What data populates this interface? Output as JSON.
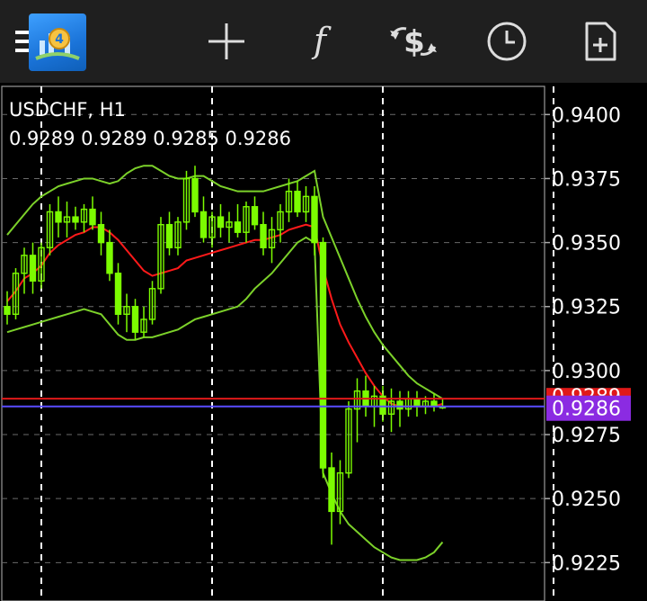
{
  "toolbar": {
    "icons": [
      "menu-icon",
      "app-logo-icon",
      "crosshair-icon",
      "function-icon",
      "trade-icon",
      "clock-icon",
      "new-document-icon"
    ],
    "function_glyph": "f"
  },
  "chart": {
    "symbol": "USDCHF, H1",
    "ohlc": "0.9289 0.9289 0.9285 0.9286",
    "bid_price": "0.9286",
    "ask_price": "0.9289",
    "bid_color": "#8B2BE2",
    "ask_color": "#E01919",
    "bull_color": "#7CFC00",
    "indicator_color": "#7CD12A",
    "ma_color": "#FF1A1A"
  },
  "chart_data": {
    "type": "candlestick",
    "title": "USDCHF, H1",
    "ylim": [
      0.921,
      0.9411
    ],
    "y_ticks": [
      "0.9400",
      "0.9375",
      "0.9350",
      "0.9325",
      "0.9300",
      "0.9275",
      "0.9250",
      "0.9225"
    ],
    "y_tick_values": [
      0.94,
      0.9375,
      0.935,
      0.9325,
      0.93,
      0.9275,
      0.925,
      0.9225
    ],
    "grid": true,
    "period_separators": 4,
    "series": [
      {
        "name": "candles",
        "values": [
          [
            0.9325,
            0.9331,
            0.9318,
            0.9322
          ],
          [
            0.9322,
            0.934,
            0.932,
            0.9338
          ],
          [
            0.9338,
            0.9348,
            0.933,
            0.9345
          ],
          [
            0.9345,
            0.935,
            0.933,
            0.9335
          ],
          [
            0.9335,
            0.935,
            0.9332,
            0.9348
          ],
          [
            0.9348,
            0.9365,
            0.9345,
            0.9362
          ],
          [
            0.9362,
            0.9368,
            0.9352,
            0.9358
          ],
          [
            0.9358,
            0.9366,
            0.9352,
            0.936
          ],
          [
            0.936,
            0.9364,
            0.9355,
            0.9358
          ],
          [
            0.9358,
            0.9365,
            0.9354,
            0.9363
          ],
          [
            0.9363,
            0.9368,
            0.9355,
            0.9357
          ],
          [
            0.9357,
            0.9362,
            0.9345,
            0.935
          ],
          [
            0.935,
            0.9355,
            0.9335,
            0.9338
          ],
          [
            0.9338,
            0.9342,
            0.9318,
            0.9322
          ],
          [
            0.9322,
            0.933,
            0.9315,
            0.9325
          ],
          [
            0.9325,
            0.9328,
            0.9312,
            0.9315
          ],
          [
            0.9315,
            0.9325,
            0.9313,
            0.932
          ],
          [
            0.932,
            0.9335,
            0.9318,
            0.9332
          ],
          [
            0.9332,
            0.936,
            0.933,
            0.9357
          ],
          [
            0.9357,
            0.9362,
            0.9345,
            0.9348
          ],
          [
            0.9348,
            0.936,
            0.9345,
            0.9358
          ],
          [
            0.9358,
            0.9378,
            0.9355,
            0.9375
          ],
          [
            0.9375,
            0.938,
            0.936,
            0.9362
          ],
          [
            0.9362,
            0.9368,
            0.935,
            0.9352
          ],
          [
            0.9352,
            0.9362,
            0.9348,
            0.936
          ],
          [
            0.936,
            0.9365,
            0.9352,
            0.9356
          ],
          [
            0.9356,
            0.9362,
            0.935,
            0.9358
          ],
          [
            0.9358,
            0.9365,
            0.9352,
            0.9354
          ],
          [
            0.9354,
            0.9366,
            0.935,
            0.9364
          ],
          [
            0.9364,
            0.9368,
            0.9355,
            0.9357
          ],
          [
            0.9357,
            0.9362,
            0.9345,
            0.9348
          ],
          [
            0.9348,
            0.936,
            0.9342,
            0.9355
          ],
          [
            0.9355,
            0.9365,
            0.935,
            0.9362
          ],
          [
            0.9362,
            0.9375,
            0.9358,
            0.937
          ],
          [
            0.937,
            0.9374,
            0.936,
            0.9362
          ],
          [
            0.9362,
            0.9372,
            0.9358,
            0.9368
          ],
          [
            0.9368,
            0.9372,
            0.9345,
            0.935
          ],
          [
            0.935,
            0.9352,
            0.9258,
            0.9262
          ],
          [
            0.9262,
            0.9268,
            0.9232,
            0.9245
          ],
          [
            0.9245,
            0.9265,
            0.924,
            0.926
          ],
          [
            0.926,
            0.9288,
            0.9258,
            0.9285
          ],
          [
            0.9285,
            0.9297,
            0.9272,
            0.9292
          ],
          [
            0.9292,
            0.9298,
            0.9282,
            0.9286
          ],
          [
            0.9286,
            0.9294,
            0.9278,
            0.929
          ],
          [
            0.929,
            0.9294,
            0.928,
            0.9283
          ],
          [
            0.9283,
            0.9293,
            0.9276,
            0.9288
          ],
          [
            0.9288,
            0.9292,
            0.9278,
            0.9285
          ],
          [
            0.9285,
            0.9292,
            0.9282,
            0.9289
          ],
          [
            0.9289,
            0.9292,
            0.9282,
            0.9286
          ],
          [
            0.9286,
            0.929,
            0.9283,
            0.9288
          ],
          [
            0.9288,
            0.9291,
            0.9284,
            0.9286
          ],
          [
            0.9286,
            0.9289,
            0.9285,
            0.9286
          ]
        ]
      },
      {
        "name": "band-mid",
        "values": [
          0.9327,
          0.9331,
          0.9336,
          0.9338,
          0.9341,
          0.9346,
          0.9349,
          0.9351,
          0.9353,
          0.9354,
          0.9356,
          0.9356,
          0.9354,
          0.9351,
          0.9347,
          0.9343,
          0.9339,
          0.9337,
          0.9338,
          0.9339,
          0.934,
          0.9343,
          0.9344,
          0.9345,
          0.9346,
          0.9347,
          0.9348,
          0.9349,
          0.935,
          0.9351,
          0.9351,
          0.9352,
          0.9353,
          0.9355,
          0.9356,
          0.9357,
          0.9356,
          0.934,
          0.9328,
          0.9318,
          0.9311,
          0.9305,
          0.9299,
          0.9294,
          0.929,
          0.9287,
          0.9286,
          0.9286,
          0.9286,
          0.9286,
          0.9286,
          0.9287
        ]
      },
      {
        "name": "band-upper",
        "values": [
          0.9353,
          0.9357,
          0.9361,
          0.9365,
          0.9368,
          0.937,
          0.9372,
          0.9373,
          0.9374,
          0.9375,
          0.9375,
          0.9374,
          0.9373,
          0.9374,
          0.9377,
          0.9379,
          0.938,
          0.938,
          0.9378,
          0.9376,
          0.9375,
          0.9375,
          0.9376,
          0.9376,
          0.9374,
          0.9372,
          0.9371,
          0.937,
          0.937,
          0.937,
          0.937,
          0.9371,
          0.9372,
          0.9373,
          0.9374,
          0.9376,
          0.9378,
          0.936,
          0.9352,
          0.9344,
          0.9336,
          0.9328,
          0.9321,
          0.9315,
          0.931,
          0.9306,
          0.9302,
          0.9298,
          0.9295,
          0.9293,
          0.9291,
          0.9289
        ]
      },
      {
        "name": "band-lower",
        "values": [
          0.9315,
          0.9316,
          0.9317,
          0.9318,
          0.9319,
          0.932,
          0.9321,
          0.9322,
          0.9323,
          0.9324,
          0.9323,
          0.9322,
          0.9318,
          0.9314,
          0.9312,
          0.9312,
          0.9313,
          0.9313,
          0.9314,
          0.9315,
          0.9316,
          0.9318,
          0.932,
          0.9321,
          0.9322,
          0.9323,
          0.9324,
          0.9325,
          0.9328,
          0.9332,
          0.9335,
          0.9338,
          0.9342,
          0.9346,
          0.935,
          0.9352,
          0.935,
          0.926,
          0.9252,
          0.9245,
          0.924,
          0.9237,
          0.9234,
          0.9231,
          0.9229,
          0.9227,
          0.9226,
          0.9226,
          0.9226,
          0.9227,
          0.9229,
          0.9233
        ]
      }
    ]
  }
}
